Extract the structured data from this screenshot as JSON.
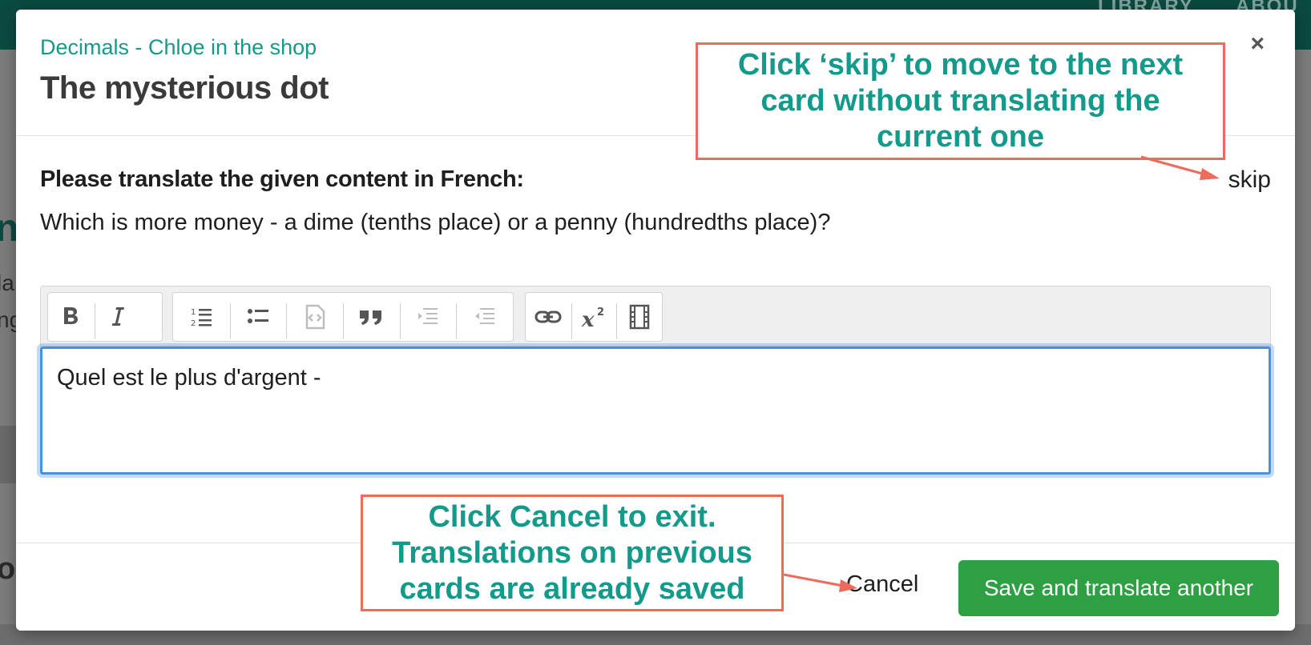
{
  "background": {
    "nav_items": [
      "LIBRARY",
      "ABOU"
    ],
    "fragments": [
      "n",
      "la",
      "ng",
      "o"
    ]
  },
  "modal": {
    "breadcrumb": "Decimals - Chloe in the shop",
    "title": "The mysterious dot",
    "close_label": "×",
    "prompt_label": "Please translate the given content in French:",
    "skip_label": "skip",
    "source_text": "Which is more money - a dime (tenths place) or a penny (hundredths place)?",
    "editor_value": "Quel est le plus d'argent -",
    "cancel_label": "Cancel",
    "save_label": "Save and translate another"
  },
  "toolbar": {
    "groups": [
      [
        "bold-icon",
        "italic-icon"
      ],
      [
        "numbered-list-icon",
        "bulleted-list-icon",
        "code-block-icon",
        "blockquote-icon",
        "indent-icon",
        "outdent-icon"
      ],
      [
        "link-icon",
        "superscript-icon",
        "video-icon"
      ]
    ]
  },
  "annotations": {
    "skip_callout": "Click ‘skip’ to move to the next card without translating the current one",
    "cancel_callout": "Click Cancel to exit. Translations on previous cards are already saved"
  },
  "colors": {
    "accent_teal": "#139a8a",
    "save_green": "#2ea043",
    "callout_border": "#ee6a5a",
    "focus_blue": "#4a90e2"
  }
}
